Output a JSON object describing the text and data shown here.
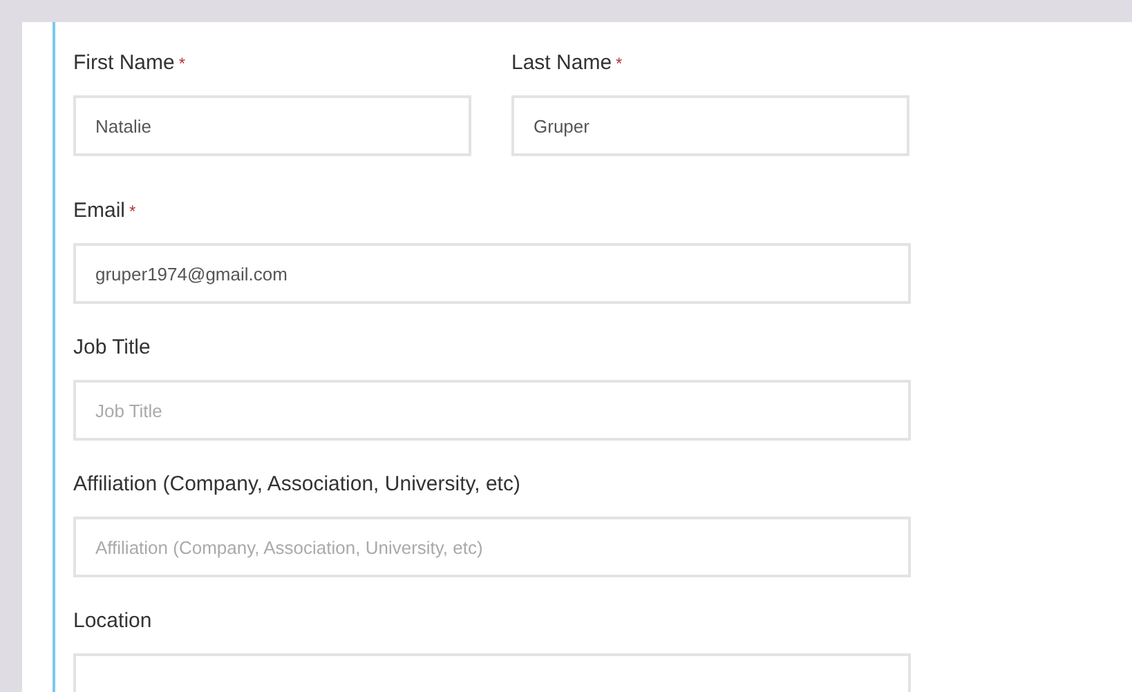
{
  "form": {
    "rows": [
      [
        {
          "label": "First Name",
          "required_mark": "*",
          "value": "Natalie"
        },
        {
          "label": "Last Name",
          "required_mark": "*",
          "value": "Gruper"
        }
      ],
      [
        {
          "label": "Email",
          "required_mark": "*",
          "value": "gruper1974@gmail.com"
        }
      ],
      [
        {
          "label": "Job Title",
          "placeholder": "Job Title"
        }
      ],
      [
        {
          "label": "Affiliation (Company, Association, University, etc)",
          "placeholder": "Affiliation (Company, Association, University, etc)"
        }
      ],
      [
        {
          "label": "Location"
        }
      ]
    ]
  }
}
